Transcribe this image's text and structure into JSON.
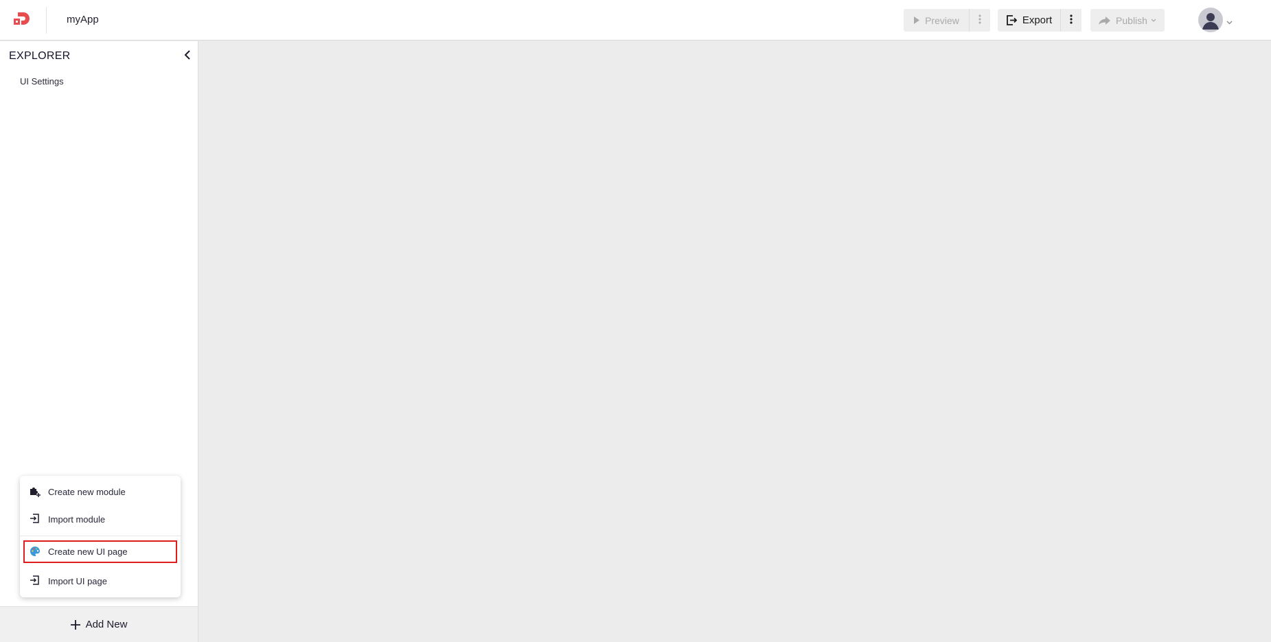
{
  "header": {
    "app_title": "myApp",
    "preview_label": "Preview",
    "export_label": "Export",
    "publish_label": "Publish"
  },
  "sidebar": {
    "title": "EXPLORER",
    "items": [
      {
        "label": "UI Settings"
      }
    ],
    "add_new_label": "Add New"
  },
  "menu": {
    "items": [
      {
        "label": "Create new module",
        "icon": "puzzle-plus-icon"
      },
      {
        "label": "Import module",
        "icon": "import-icon"
      },
      {
        "label": "Create new UI page",
        "icon": "palette-icon",
        "highlighted": true
      },
      {
        "label": "Import UI page",
        "icon": "import-icon"
      }
    ]
  },
  "colors": {
    "brand": "#e84c4f",
    "highlight_border": "#e01b1b",
    "canvas_bg": "#ececec",
    "palette_icon": "#3a9ad9"
  }
}
